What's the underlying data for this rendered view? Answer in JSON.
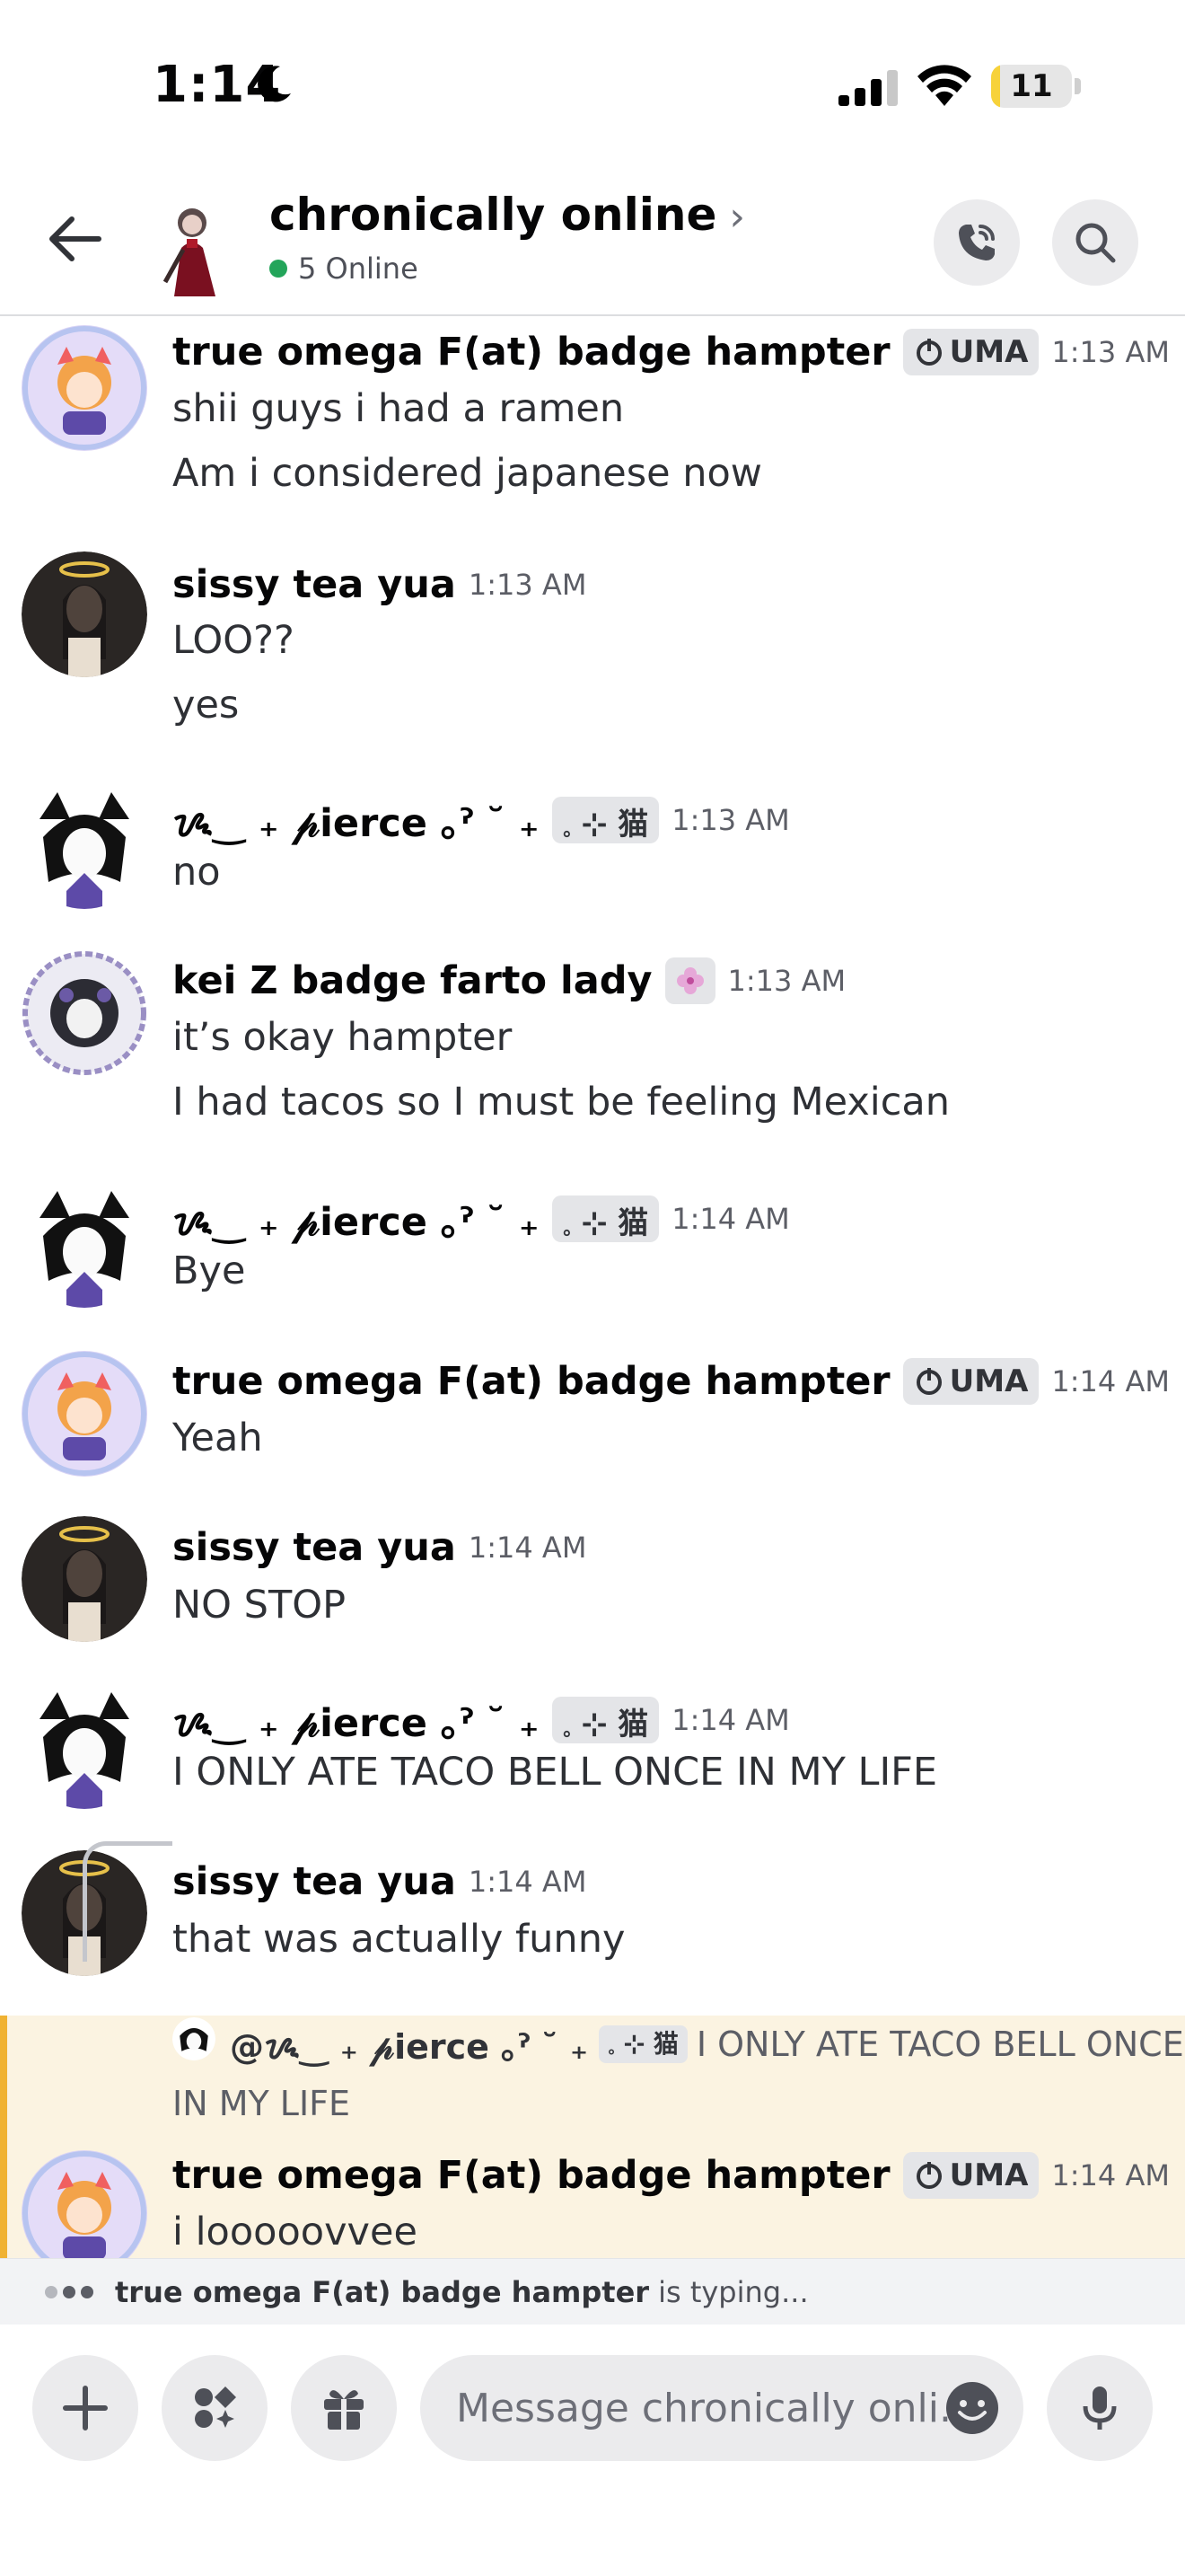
{
  "status_bar": {
    "time": "1:14",
    "battery": "11",
    "battery_level_percent": 11
  },
  "header": {
    "back_icon": "arrow-left-icon",
    "channel_name": "chronically online",
    "chevron": "›",
    "online_count": "5 Online",
    "online_color": "#23a55a",
    "call_icon": "phone-call-icon",
    "search_icon": "search-icon"
  },
  "messages": [
    {
      "author": "true omega F(at) badge hampter",
      "tag": "UMA",
      "time": "1:13 AM",
      "lines": [
        "shii guys i had a ramen",
        "Am i considered japanese now"
      ]
    },
    {
      "author": "sissy tea yua",
      "time": "1:13 AM",
      "lines": [
        "LOO??",
        "yes"
      ]
    },
    {
      "author": "ᝰ‿ ₊ 𝓅ierce ｡ˀ ˘ ₊",
      "tag": "𓈒 ⊹ 猫",
      "time": "1:13 AM",
      "lines": [
        "no"
      ]
    },
    {
      "author": "kei Z badge farto lady",
      "time": "1:13 AM",
      "lines": [
        "it’s okay hampter",
        "I had tacos so I must be feeling Mexican"
      ]
    },
    {
      "author": "ᝰ‿ ₊ 𝓅ierce ｡ˀ ˘ ₊",
      "tag": "𓈒 ⊹ 猫",
      "time": "1:14 AM",
      "lines": [
        "Bye"
      ]
    },
    {
      "author": "true omega F(at) badge hampter",
      "tag": "UMA",
      "time": "1:14 AM",
      "lines": [
        "Yeah"
      ]
    },
    {
      "author": "sissy tea yua",
      "time": "1:14 AM",
      "lines": [
        "NO STOP"
      ]
    },
    {
      "author": "ᝰ‿ ₊ 𝓅ierce ｡ˀ ˘ ₊",
      "tag": "𓈒 ⊹ 猫",
      "time": "1:14 AM",
      "lines": [
        "I ONLY ATE TACO BELL ONCE IN MY LIFE"
      ]
    },
    {
      "author": "sissy tea yua",
      "time": "1:14 AM",
      "lines": [
        "that was actually funny"
      ]
    },
    {
      "author": "true omega F(at) badge hampter",
      "tag": "UMA",
      "time": "1:14 AM",
      "lines": [
        "i looooovvee"
      ]
    }
  ],
  "reply": {
    "mention": "@ᝰ‿ ₊ 𝓅ierce ｡ˀ ˘ ₊",
    "tag": "𓈒 ⊹ 猫",
    "text_first": "I ONLY ATE TACO BELL ONCE",
    "text_second": "IN MY LIFE"
  },
  "typing": {
    "name": "true omega F(at) badge hampter",
    "suffix": "is typing..."
  },
  "composer": {
    "placeholder": "Message chronically onli..",
    "plus_icon": "plus-icon",
    "apps_icon": "apps-icon",
    "gift_icon": "gift-icon",
    "emoji_icon": "emoji-icon",
    "mic_icon": "microphone-icon"
  },
  "colors": {
    "highlight_bg": "#fbf3e1",
    "highlight_bar": "#f0b232",
    "tag_bg": "#e4e5e8"
  }
}
